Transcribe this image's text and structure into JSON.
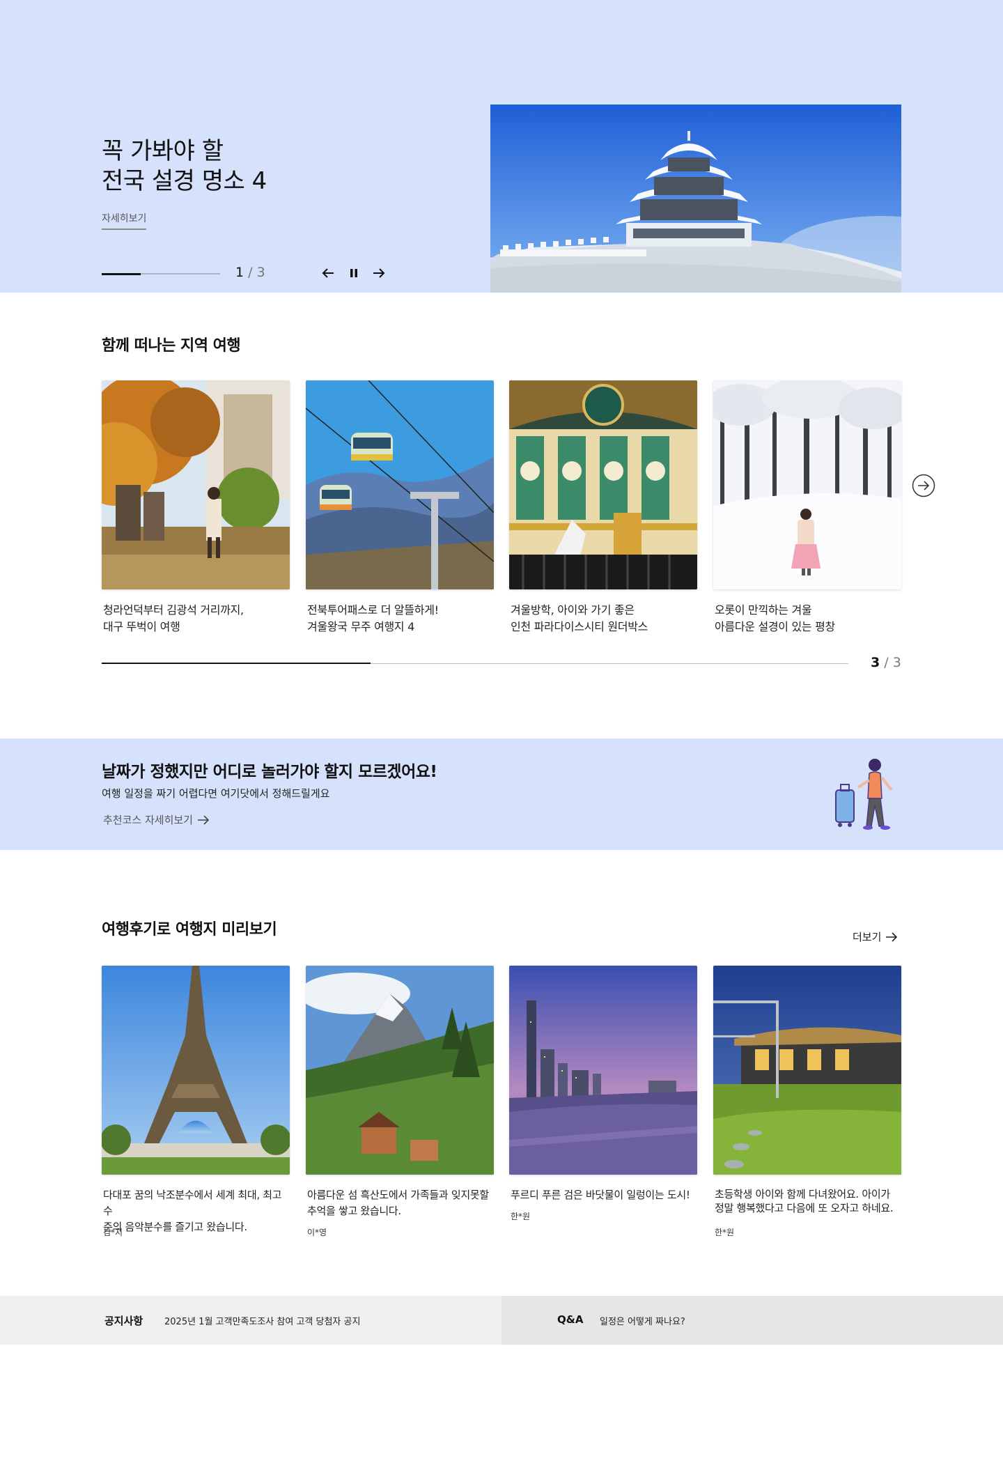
{
  "hero": {
    "title_line1": "꼭 가봐야 할",
    "title_line2": "전국 설경 명소 4",
    "more_label": "자세히보기",
    "current": "1",
    "separator": "/",
    "total": "3",
    "progress": 0.33,
    "image_icon": "snowy-pavilion-photo",
    "prev_icon": "arrow-left-icon",
    "pause_icon": "pause-icon",
    "next_icon": "arrow-right-icon"
  },
  "region": {
    "title": "함께 떠나는 지역 여행",
    "cards": [
      {
        "line1": "청라언덕부터 김광석 거리까지,",
        "line2": "대구 뚜벅이 여행",
        "image_icon": "autumn-park-photo"
      },
      {
        "line1": "전북투어패스로 더 알뜰하게!",
        "line2": "겨울왕국 무주 여행지 4",
        "image_icon": "cable-car-photo"
      },
      {
        "line1": "겨울방학, 아이와 가기 좋은",
        "line2": "인천 파라다이스시티 원더박스",
        "image_icon": "carousel-photo"
      },
      {
        "line1": "오롯이 만끽하는 겨울",
        "line2": "아름다운 설경이 있는 평창",
        "image_icon": "snow-forest-photo"
      }
    ],
    "next_icon": "circle-arrow-right-icon",
    "current": "3",
    "separator": "/",
    "total": "3",
    "progress": 0.36
  },
  "banner": {
    "title": "날짜가 정했지만 어디로 놀러가야 할지 모르겠어요!",
    "subtitle": "여행 일정을 짜기 어렵다면 여기닷에서 정해드릴게요",
    "link_label": "추천코스 자세히보기",
    "link_icon": "arrow-right-icon",
    "illustration_icon": "traveler-with-suitcase-illustration"
  },
  "reviews": {
    "title": "여행후기로 여행지 미리보기",
    "more_label": "더보기",
    "more_icon": "arrow-right-icon",
    "cards": [
      {
        "line1": "다대포 꿈의 낙조분수에서 세계 최대, 최고 수",
        "line2": "준의 음악분수를 즐기고 왔습니다.",
        "author": "김*지",
        "image_icon": "eiffel-tower-photo"
      },
      {
        "line1": "아름다운 섬 흑산도에서 가족들과 잊지못할",
        "line2": "추억을 쌓고 왔습니다.",
        "author": "이*영",
        "image_icon": "matterhorn-village-photo"
      },
      {
        "line1": "푸르디 푸른 검은 바닷물이 일렁이는 도시!",
        "line2": "",
        "author": "한*원",
        "image_icon": "city-night-river-photo"
      },
      {
        "line1": "초등학생 아이와 함께 다녀왔어요. 아이가",
        "line2": "정말 행복했다고 다음에 또 오자고 하네요.",
        "author": "한*원",
        "image_icon": "garden-house-dusk-photo"
      }
    ]
  },
  "footer": {
    "notice_label": "공지사항",
    "notice_text": "2025년 1월 고객만족도조사 참여 고객 당첨자 공지",
    "qna_label": "Q&A",
    "qna_text": "일정은 어떻게 짜나요?"
  }
}
